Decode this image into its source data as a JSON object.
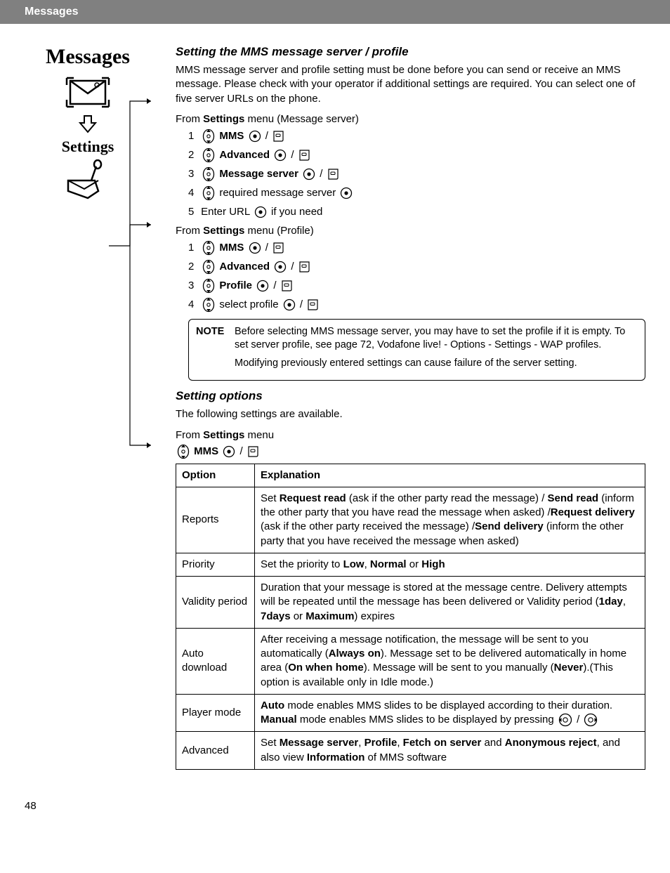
{
  "header": {
    "title": "Messages"
  },
  "left": {
    "title": "Messages",
    "sub": "Settings"
  },
  "s1": {
    "title": "Setting the MMS message server / profile",
    "intro": "MMS message server and profile setting must be done before you can send or receive an MMS message. Please check with your operator if additional settings are required. You can select one of five server URLs on the phone.",
    "proc1_from_pre": "From ",
    "proc1_from_bold": "Settings",
    "proc1_from_post": " menu (Message server)",
    "proc1": {
      "s1": "MMS",
      "s2": "Advanced",
      "s3": "Message server",
      "s4_text": "required message server",
      "s5_pre": "Enter URL ",
      "s5_post": " if you need"
    },
    "proc2_from_pre": "From ",
    "proc2_from_bold": "Settings",
    "proc2_from_post": " menu (Profile)",
    "proc2": {
      "s1": "MMS",
      "s2": "Advanced",
      "s3": "Profile",
      "s4_text": "select profile"
    },
    "note_label": "NOTE",
    "note_p1": "Before selecting MMS message server, you may have to set the profile if it is empty. To set server profile, see page 72, Vodafone live! - Options - Settings - WAP profiles.",
    "note_p2": "Modifying previously entered settings can cause failure of the server setting."
  },
  "s2": {
    "title": "Setting options",
    "intro": "The following settings are available.",
    "from_pre": "From ",
    "from_bold": "Settings",
    "from_post": " menu",
    "mms": "MMS",
    "th_option": "Option",
    "th_expl": "Explanation",
    "rows": {
      "r0_opt": "Reports",
      "r0_t0": "Set ",
      "r0_b0": "Request read",
      "r0_t1": " (ask if the other party read the message) / ",
      "r0_b1": "Send read",
      "r0_t2": " (inform the other party that you have read the message when asked) /",
      "r0_b2": "Request delivery",
      "r0_t3": " (ask if the other party received the message) /",
      "r0_b3": "Send delivery",
      "r0_t4": " (inform the other party that you have received the message when asked)",
      "r1_opt": "Priority",
      "r1_t0": "Set the priority to ",
      "r1_b0": "Low",
      "r1_t1": ", ",
      "r1_b1": "Normal",
      "r1_t2": " or ",
      "r1_b2": "High",
      "r2_opt": "Validity period",
      "r2_t0": "Duration that your message is stored at the message centre. Delivery attempts will be repeated until the message has been delivered or Validity period (",
      "r2_b0": "1day",
      "r2_t1": ", ",
      "r2_b1": "7days",
      "r2_t2": " or ",
      "r2_b2": "Maximum",
      "r2_t3": ") expires",
      "r3_opt": "Auto download",
      "r3_t0": "After receiving a message notification, the message will be sent to you automatically (",
      "r3_b0": "Always on",
      "r3_t1": "). Message set to be delivered automatically in home area (",
      "r3_b1": "On when home",
      "r3_t2": "). Message will be sent to you manually (",
      "r3_b2": "Never",
      "r3_t3": ").(This option is available only in Idle mode.)",
      "r4_opt": "Player mode",
      "r4_b0": "Auto",
      "r4_t0": " mode enables MMS slides to be displayed according to their duration. ",
      "r4_b1": "Manual",
      "r4_t1": " mode enables MMS slides to be displayed by pressing ",
      "r5_opt": "Advanced",
      "r5_t0": "Set ",
      "r5_b0": "Message server",
      "r5_t1": ", ",
      "r5_b1": "Profile",
      "r5_t2": ", ",
      "r5_b2": "Fetch on server",
      "r5_t3": " and ",
      "r5_b3": "Anonymous reject",
      "r5_t4": ", and also view ",
      "r5_b4": "Information",
      "r5_t5": " of MMS software"
    }
  },
  "page_number": "48",
  "slash": " / "
}
